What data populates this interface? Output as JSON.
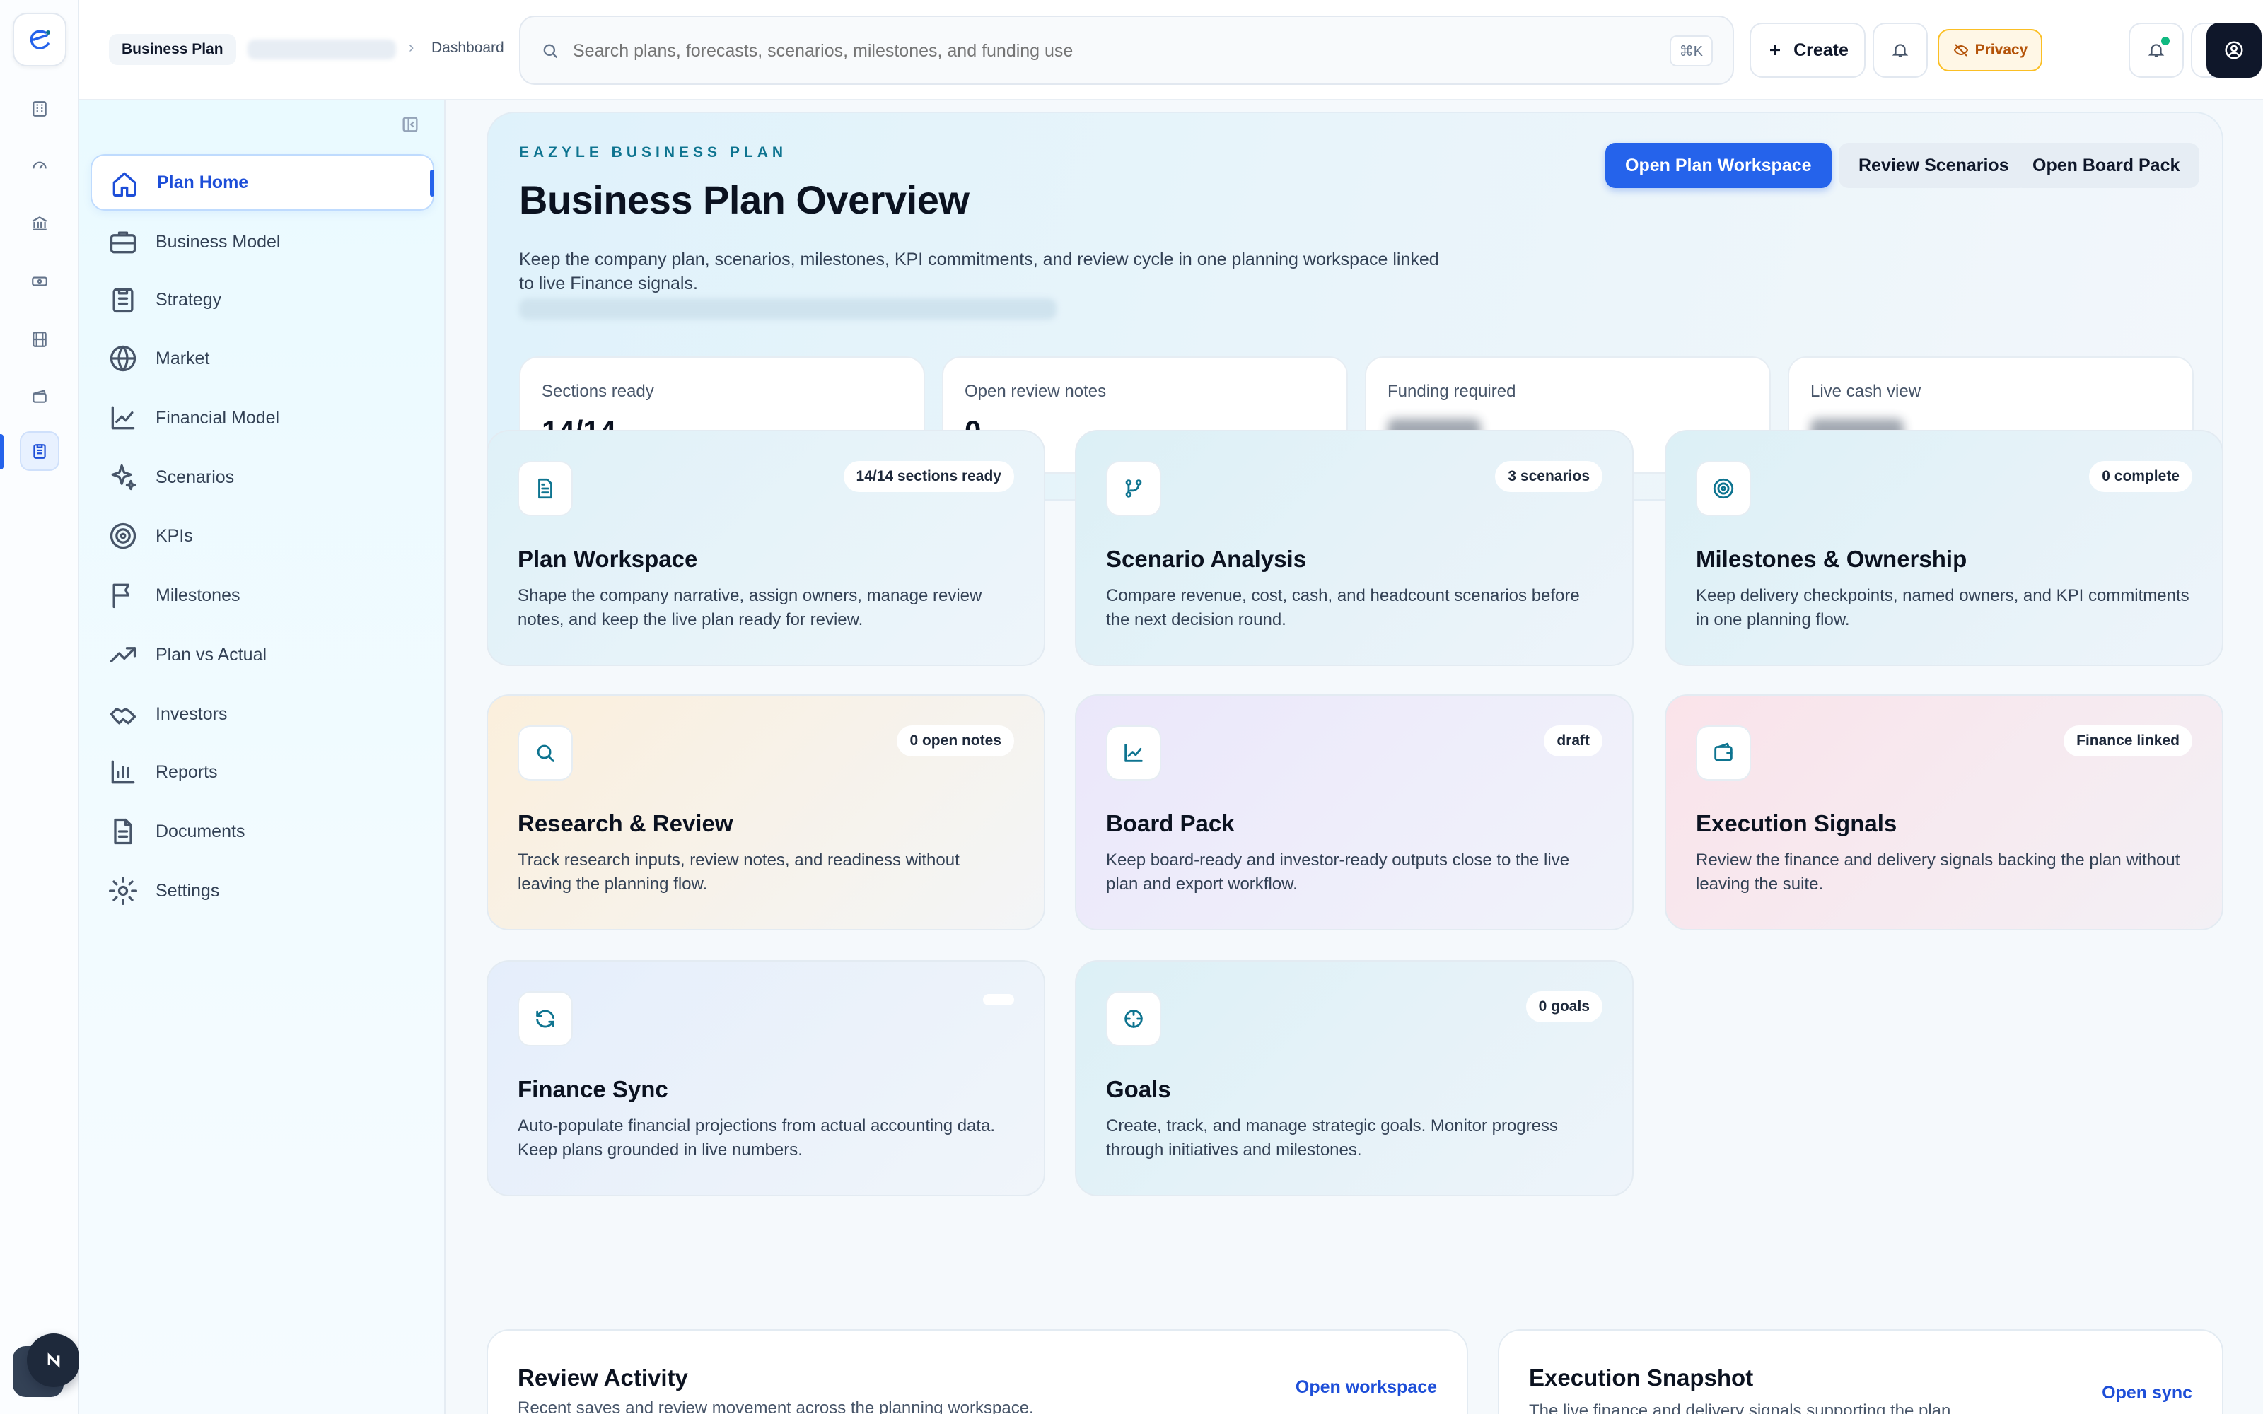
{
  "topbar": {
    "breadcrumb_root": "Business Plan",
    "breadcrumb_last": "Dashboard",
    "search_placeholder": "Search plans, forecasts, scenarios, milestones, and funding use",
    "search_shortcut": "⌘K",
    "create_label": "Create",
    "privacy_label": "Privacy"
  },
  "sidebar": {
    "items": [
      {
        "label": "Plan Home",
        "icon": "home-icon",
        "active": true
      },
      {
        "label": "Business Model",
        "icon": "briefcase-icon"
      },
      {
        "label": "Strategy",
        "icon": "clipboard-icon"
      },
      {
        "label": "Market",
        "icon": "globe-icon"
      },
      {
        "label": "Financial Model",
        "icon": "line-chart-icon"
      },
      {
        "label": "Scenarios",
        "icon": "sparkles-icon"
      },
      {
        "label": "KPIs",
        "icon": "target-icon"
      },
      {
        "label": "Milestones",
        "icon": "flag-icon"
      },
      {
        "label": "Plan vs Actual",
        "icon": "trending-up-icon"
      },
      {
        "label": "Investors",
        "icon": "handshake-icon"
      },
      {
        "label": "Reports",
        "icon": "bar-chart-icon"
      },
      {
        "label": "Documents",
        "icon": "document-icon"
      },
      {
        "label": "Settings",
        "icon": "gear-icon"
      }
    ]
  },
  "hero": {
    "eyebrow": "EAZYLE BUSINESS PLAN",
    "title": "Business Plan Overview",
    "description": "Keep the company plan, scenarios, milestones, KPI commitments, and review cycle in one planning workspace linked to live Finance signals.",
    "buttons": {
      "primary": "Open Plan Workspace",
      "scenarios": "Review Scenarios",
      "board": "Open Board Pack"
    },
    "stats": [
      {
        "label": "Sections ready",
        "value": "14/14"
      },
      {
        "label": "Open review notes",
        "value": "0"
      },
      {
        "label": "Funding required",
        "value": ""
      },
      {
        "label": "Live cash view",
        "value": ""
      }
    ]
  },
  "cards": [
    {
      "title": "Plan Workspace",
      "badge": "14/14 sections ready",
      "icon": "file-text-icon",
      "description": "Shape the company narrative, assign owners, manage review notes, and keep the live plan ready for review."
    },
    {
      "title": "Scenario Analysis",
      "badge": "3 scenarios",
      "icon": "git-branch-icon",
      "description": "Compare revenue, cost, cash, and headcount scenarios before the next decision round."
    },
    {
      "title": "Milestones & Ownership",
      "badge": "0 complete",
      "icon": "target-icon",
      "description": "Keep delivery checkpoints, named owners, and KPI commitments in one planning flow."
    },
    {
      "title": "Research & Review",
      "badge": "0 open notes",
      "icon": "search-icon",
      "description": "Track research inputs, review notes, and readiness without leaving the planning flow."
    },
    {
      "title": "Board Pack",
      "badge": "draft",
      "icon": "line-chart-icon",
      "description": "Keep board-ready and investor-ready outputs close to the live plan and export workflow."
    },
    {
      "title": "Execution Signals",
      "badge": "Finance linked",
      "icon": "wallet-icon",
      "description": "Review the finance and delivery signals backing the plan without leaving the suite."
    },
    {
      "title": "Finance Sync",
      "badge": "",
      "icon": "refresh-icon",
      "description": "Auto-populate financial projections from actual accounting data. Keep plans grounded in live numbers."
    },
    {
      "title": "Goals",
      "badge": "0 goals",
      "icon": "crosshair-icon",
      "description": "Create, track, and manage strategic goals. Monitor progress through initiatives and milestones."
    }
  ],
  "bottom": {
    "review": {
      "title": "Review Activity",
      "subtitle": "Recent saves and review movement across the planning workspace.",
      "link": "Open workspace"
    },
    "execution": {
      "title": "Execution Snapshot",
      "subtitle": "The live finance and delivery signals supporting the plan.",
      "link": "Open sync"
    }
  },
  "colors": {
    "accent": "#2563eb",
    "eyebrow": "#0e7490",
    "privacy": "#b45309"
  }
}
